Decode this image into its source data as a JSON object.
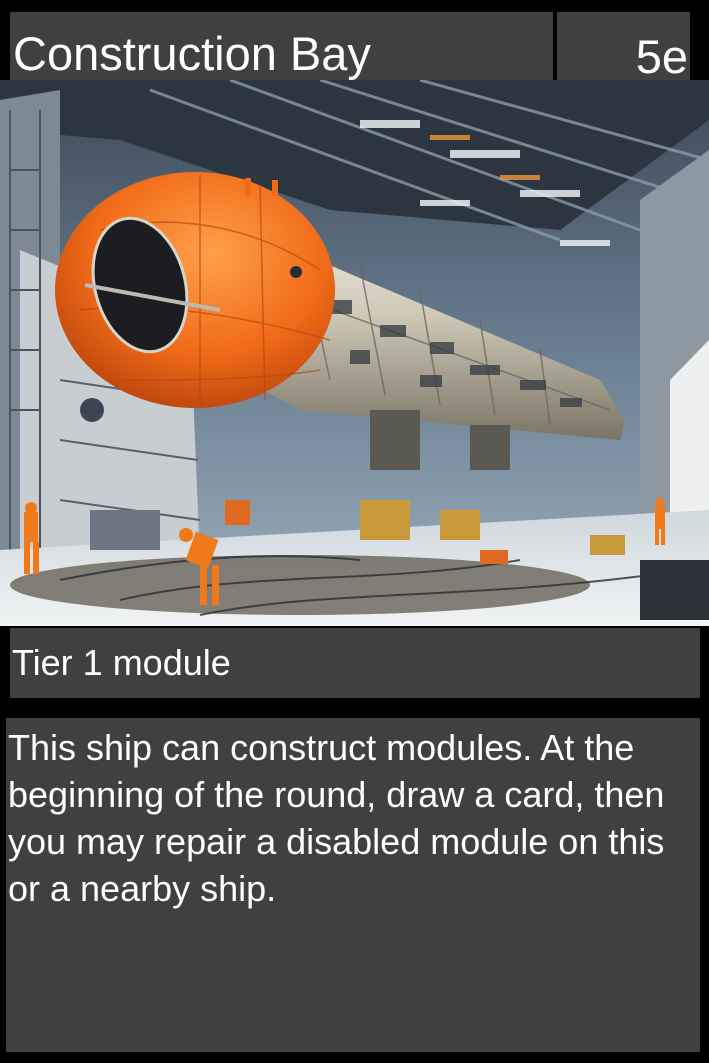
{
  "card": {
    "title": "Construction Bay",
    "cost": "5e",
    "type_line": "Tier 1 module",
    "rules_text": "This ship can construct modules. At the beginning of the round, draw a card, then you may repair a disabled module on this or a nearby ship."
  },
  "art": {
    "subject": "construction-hangar-spaceship-illustration",
    "colors": {
      "hull_orange": "#f06a18",
      "hull_white": "#d9d4c6",
      "hangar_steel": "#5b6d7e",
      "floor_snow": "#e6ebee",
      "panel_gray": "#404040"
    }
  }
}
